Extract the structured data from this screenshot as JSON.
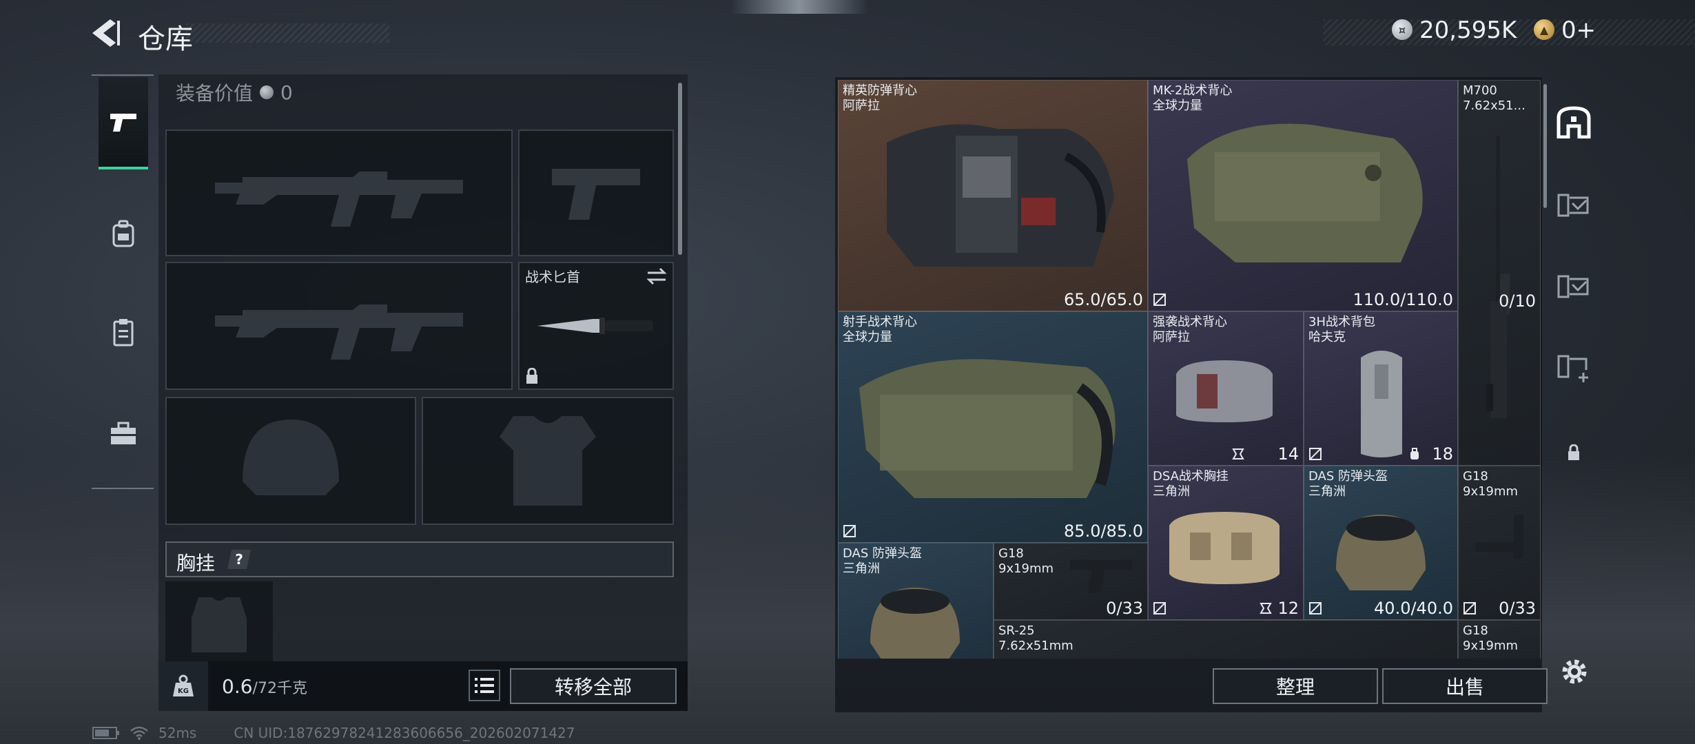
{
  "header": {
    "title": "仓库",
    "currency_primary": "20,595K",
    "currency_secondary": "0+"
  },
  "loadout": {
    "equip_value_label": "装备价值",
    "equip_value": "0",
    "knife_slot_label": "战术匕首",
    "chest_rig_section": "胸挂",
    "help_symbol": "?",
    "weight_value": "0.6",
    "weight_max": "/72千克",
    "transfer_all": "转移全部"
  },
  "stash": {
    "items": [
      {
        "name": "精英防弹背心",
        "sub": "阿萨拉",
        "value": "65.0/65.0"
      },
      {
        "name": "MK-2战术背心",
        "sub": "全球力量",
        "value": "110.0/110.0"
      },
      {
        "name": "M700",
        "sub": "7.62x51...",
        "value": "0/10"
      },
      {
        "name": "射手战术背心",
        "sub": "全球力量",
        "value": "85.0/85.0"
      },
      {
        "name": "强袭战术背心",
        "sub": "阿萨拉",
        "value": "14"
      },
      {
        "name": "3H战术背包",
        "sub": "哈夫克",
        "value": "18"
      },
      {
        "name": "DSA战术胸挂",
        "sub": "三角洲",
        "value": "12"
      },
      {
        "name": "DAS 防弹头盔",
        "sub": "三角洲",
        "value": "40.0/40.0"
      },
      {
        "name": "G18",
        "sub": "9x19mm",
        "value": "0/33"
      },
      {
        "name": "DAS 防弹头盔",
        "sub": "三角洲",
        "value": ""
      },
      {
        "name": "G18",
        "sub": "9x19mm",
        "value": "0/33"
      },
      {
        "name": "SR-25",
        "sub": "7.62x51mm",
        "value": ""
      },
      {
        "name": "G18",
        "sub": "9x19mm",
        "value": ""
      }
    ],
    "sort_label": "整理",
    "sell_label": "出售"
  },
  "footer": {
    "ping": "52ms",
    "uid": "CN UID:18762978241283606656_202602071427"
  },
  "colors": {
    "accent_green": "#37d49c",
    "rarity_orange": "#5b4438",
    "rarity_purple": "#3a3850",
    "rarity_blue": "#2d4354"
  },
  "icons": [
    "back-arrow-icon",
    "silver-coin-icon",
    "gold-coin-icon",
    "pistol-icon",
    "backpack-icon",
    "clipboard-icon",
    "toolbox-icon",
    "swap-icon",
    "lock-icon",
    "help-icon",
    "weight-icon",
    "list-icon",
    "safe-box-icon",
    "settings-gear-icon"
  ]
}
